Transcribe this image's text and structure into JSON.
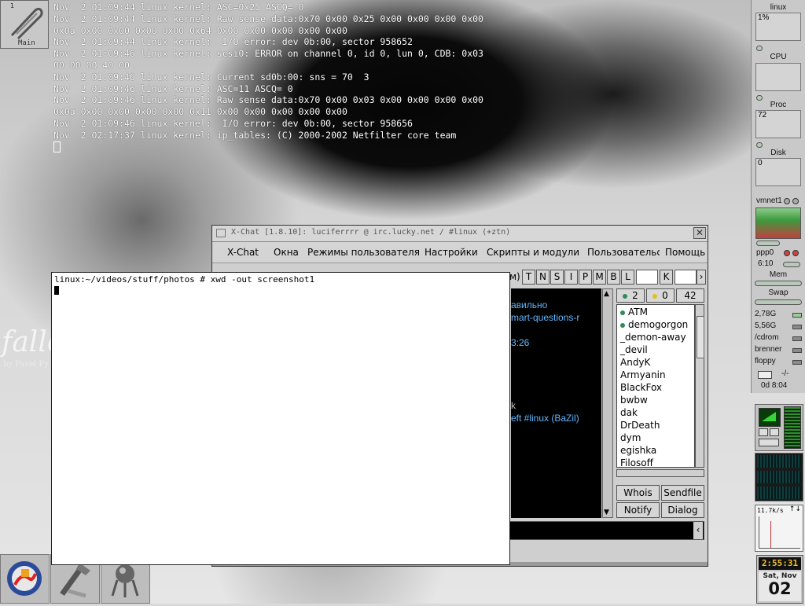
{
  "desktop": {
    "watermark": "falle",
    "watermark_sub": "by Pavel Fy",
    "pager": {
      "number": "1",
      "name": "Main"
    }
  },
  "root_log": [
    "Nov  2 01:09:44 linux kernel: ASC=0x25 ASCQ= 0",
    "Nov  2 01:09:44 linux kernel: Raw sense data:0x70 0x00 0x25 0x00 0x00 0x00 0x00",
    "0x0a 0x00 0x00 0x00 0x00 0x64 0x00 0x00 0x00 0x00 0x00",
    "Nov  2 01:09:44 linux kernel:  I/O error: dev 0b:00, sector 958652",
    "Nov  2 01:09:46 linux kernel: scsi0: ERROR on channel 0, id 0, lun 0, CDB: 0x03",
    "00 00 00 40 00",
    "Nov  2 01:09:46 linux kernel: Current sd0b:00: sns = 70  3",
    "Nov  2 01:09:46 linux kernel: ASC=11 ASCQ= 0",
    "Nov  2 01:09:46 linux kernel: Raw sense data:0x70 0x00 0x03 0x00 0x00 0x00 0x00",
    "0x0a 0x00 0x00 0x00 0x00 0x11 0x00 0x00 0x00 0x00 0x00",
    "Nov  2 01:09:46 linux kernel:  I/O error: dev 0b:00, sector 958656",
    "Nov  2 02:17:37 linux kernel: ip_tables: (C) 2000-2002 Netfilter core team"
  ],
  "monitor": {
    "host": "linux",
    "cpu_label": "CPU",
    "cpu_value": "1%",
    "proc_label": "Proc",
    "proc_value": "72",
    "disk_label": "Disk",
    "disk_value": "0",
    "net_label": "vmnet1",
    "ppp_label": "ppp0",
    "ppp_time": "6:10",
    "mem_label": "Mem",
    "swap_label": "Swap",
    "mounts": [
      "2,78G",
      "5,56G",
      "/cdrom",
      "brenner",
      "floppy"
    ],
    "mail": "-/-",
    "uptime": "0d 8:04",
    "netspeed": "11.7k/s"
  },
  "xchat": {
    "title": "X-Chat [1.8.10]: luciferrrr @ irc.lucky.net / #linux (+ztn)",
    "menu": [
      "X-Chat",
      "Окна",
      "Режимы пользователя",
      "Настройки",
      "Скрипты и модули",
      "Пользовательс",
      "Помощь"
    ],
    "mode_buttons": [
      "T",
      "N",
      "S",
      "I",
      "P",
      "M",
      "B",
      "L",
      "K"
    ],
    "toolbar_fragment": "м)",
    "chat_lines": [
      "авильно",
      "mart-questions-r",
      "3:26",
      "k",
      "eft #linux (BaZil)"
    ],
    "op_count": "2",
    "voice_count": "0",
    "total_count": "42",
    "users": [
      {
        "nick": "ATM",
        "op": true
      },
      {
        "nick": "demogorgon",
        "op": true
      },
      {
        "nick": "_demon-away",
        "op": false
      },
      {
        "nick": "_devil",
        "op": false
      },
      {
        "nick": "AndyK",
        "op": false
      },
      {
        "nick": "Armyanin",
        "op": false
      },
      {
        "nick": "BlackFox",
        "op": false
      },
      {
        "nick": "bwbw",
        "op": false
      },
      {
        "nick": "dak",
        "op": false
      },
      {
        "nick": "DrDeath",
        "op": false
      },
      {
        "nick": "dym",
        "op": false
      },
      {
        "nick": "egishka",
        "op": false
      },
      {
        "nick": "Filosoff",
        "op": false
      }
    ],
    "buttons": {
      "whois": "Whois",
      "sendfile": "Sendfile",
      "notify": "Notify",
      "dialog": "Dialog"
    }
  },
  "xterm": {
    "prompt_line": "linux:~/videos/stuff/photos # xwd -out screenshot1"
  },
  "clock": {
    "time": "2:55:31",
    "dow": "Sat, Nov",
    "day": "02"
  },
  "colors": {
    "chat_text": "#5fb6ff",
    "op_dot": "#2e8b57",
    "clock_digits": "#f0c030"
  }
}
